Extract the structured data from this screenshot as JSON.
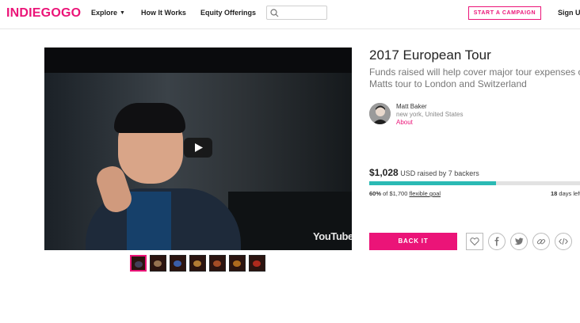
{
  "header": {
    "logo": "INDIEGOGO",
    "nav": {
      "explore": "Explore",
      "how_it_works": "How It Works",
      "equity": "Equity Offerings"
    },
    "search": {
      "placeholder": ""
    },
    "start_campaign": "START A CAMPAIGN",
    "sign_up": "Sign Up"
  },
  "video": {
    "watermark": "YouTube"
  },
  "campaign": {
    "title": "2017 European Tour",
    "tagline_line1": "Funds raised will help cover major tour expenses on",
    "tagline_line2": "Matts tour to London and Switzerland",
    "owner": {
      "name": "Matt Baker",
      "location": "new york, United States",
      "about": "About"
    },
    "funding": {
      "amount": "$1,028",
      "raised_text": " USD raised by 7 backers",
      "percent_label": "60%",
      "goal_text": " of $1,700 ",
      "goal_type": "flexible goal",
      "days_num": "18",
      "days_text": " days left",
      "progress_percent": 60
    },
    "back_it": "BACK IT"
  },
  "social_icons": [
    "heart-icon",
    "facebook-icon",
    "twitter-icon",
    "link-icon",
    "embed-icon"
  ],
  "colors": {
    "brand": "#eb1478",
    "progress": "#2bbab4"
  }
}
